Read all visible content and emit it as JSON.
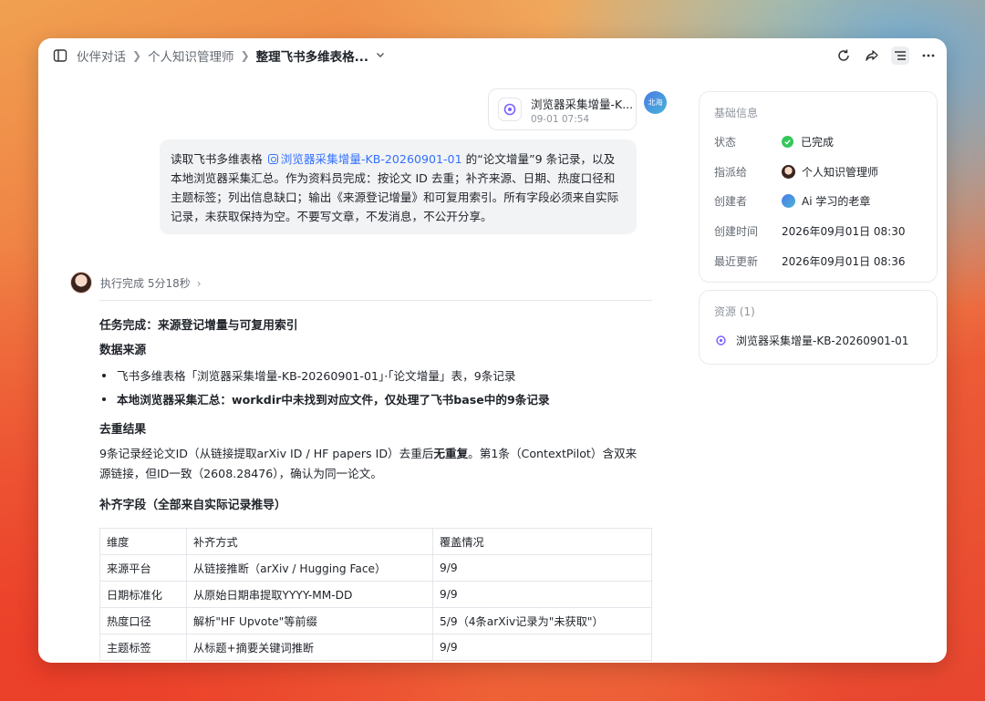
{
  "breadcrumb": {
    "items": [
      "伙伴对话",
      "个人知识管理师"
    ],
    "current": "整理飞书多维表格..."
  },
  "file_card": {
    "name": "浏览器采集增量-K...",
    "time": "09-01 07:54"
  },
  "user_avatar": {
    "label": "北海"
  },
  "message": {
    "prefix": "读取飞书多维表格",
    "link": "浏览器采集增量-KB-20260901-01",
    "rest": "的“论文增量”9 条记录，以及本地浏览器采集汇总。作为资料员完成：按论文 ID 去重；补齐来源、日期、热度口径和主题标签；列出信息缺口；输出《来源登记增量》和可复用索引。所有字段必须来自实际记录，未获取保持为空。不要写文章，不发消息，不公开分享。"
  },
  "agent": {
    "status": "执行完成 5分18秒"
  },
  "result": {
    "title": "任务完成：来源登记增量与可复用索引",
    "sources_heading": "数据来源",
    "bullet1": "飞书多维表格「浏览器采集增量-KB-20260901-01」·「论文增量」表，9条记录",
    "bullet2": "本地浏览器采集汇总：workdir中未找到对应文件，仅处理了飞书base中的9条记录",
    "dedup_heading": "去重结果",
    "dedup_text_1": "9条记录经论文ID（从链接提取arXiv ID / HF papers ID）去重后",
    "dedup_bold": "无重复",
    "dedup_text_2": "。第1条（ContextPilot）含双来源链接，但ID一致（2608.28476），确认为同一论文。",
    "fill_heading": "补齐字段（全部来自实际记录推导）",
    "table": {
      "headers": [
        "维度",
        "补齐方式",
        "覆盖情况"
      ],
      "rows": [
        [
          "来源平台",
          "从链接推断（arXiv / Hugging Face）",
          "9/9"
        ],
        [
          "日期标准化",
          "从原始日期串提取YYYY-MM-DD",
          "9/9"
        ],
        [
          "热度口径",
          "解析\"HF Upvote\"等前缀",
          "5/9（4条arXiv记录为\"未获取\"）"
        ],
        [
          "主题标签",
          "从标题+摘要关键词推断",
          "9/9"
        ]
      ]
    }
  },
  "info_panel": {
    "title": "基础信息",
    "status_label": "状态",
    "status_value": "已完成",
    "assignee_label": "指派给",
    "assignee_value": "个人知识管理师",
    "creator_label": "创建者",
    "creator_value": "Ai 学习的老章",
    "created_label": "创建时间",
    "created_value": "2026年09月01日 08:30",
    "updated_label": "最近更新",
    "updated_value": "2026年09月01日 08:36"
  },
  "resources_panel": {
    "title": "资源 (1)",
    "item": "浏览器采集增量-KB-20260901-01"
  },
  "icons": [
    "sidebar-toggle-icon",
    "refresh-icon",
    "share-icon",
    "outline-icon",
    "more-icon",
    "base-file-icon",
    "check-icon"
  ],
  "colors": {
    "accent": "#3370ff",
    "success": "#34c759"
  }
}
